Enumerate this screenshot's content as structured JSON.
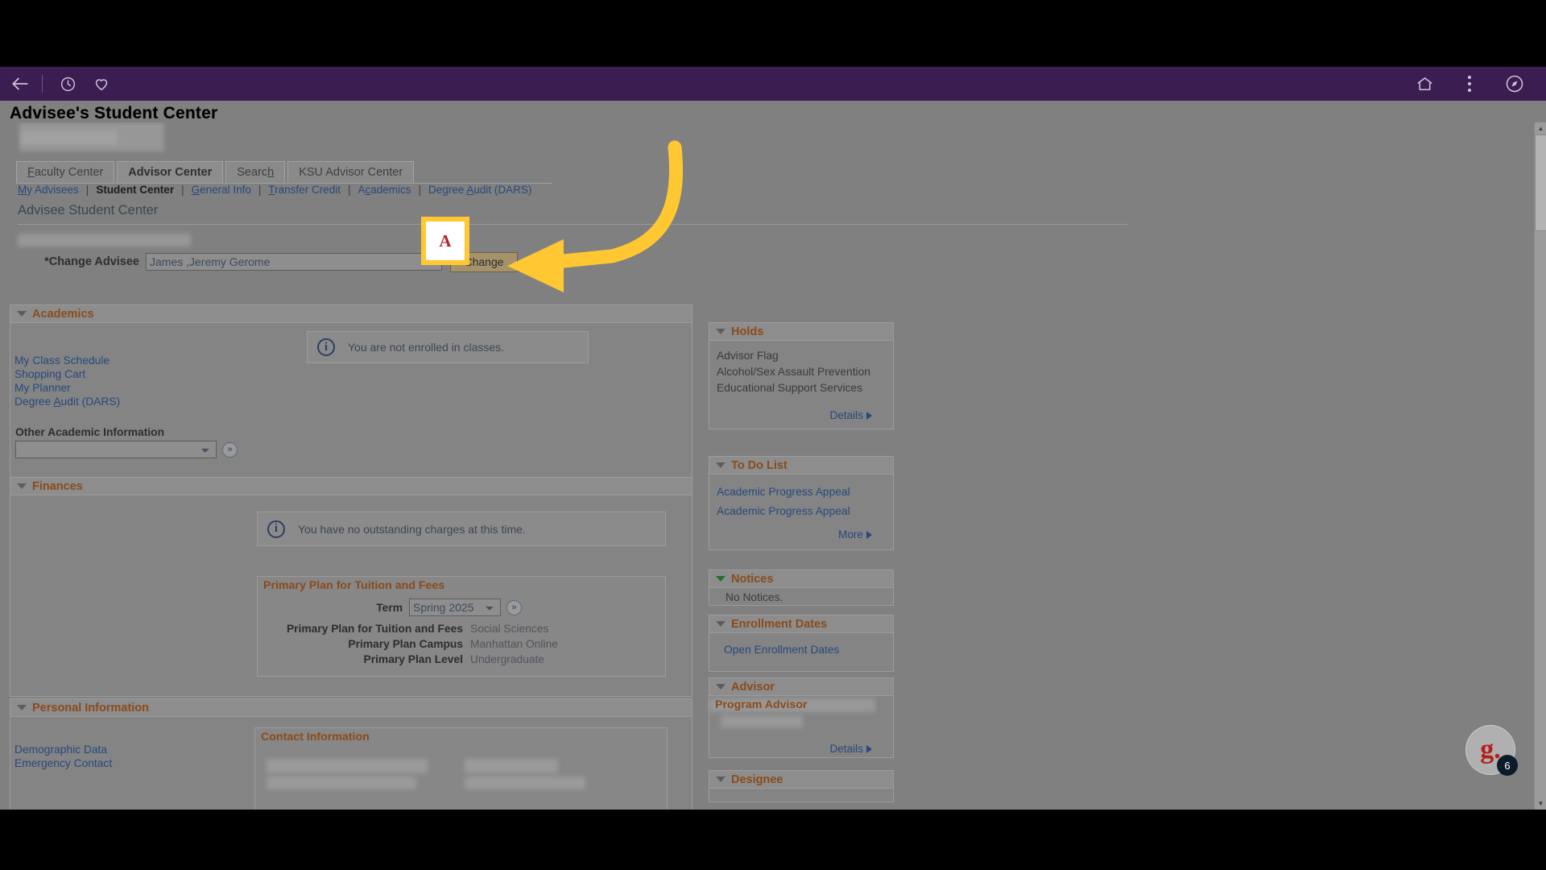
{
  "browser": {
    "icons": [
      "back-arrow-icon",
      "history-clock-icon",
      "favorites-heart-icon",
      "home-icon",
      "overflow-menu-icon",
      "compass-icon"
    ]
  },
  "page": {
    "title": "Advisee's Student Center",
    "section_title": "Advisee Student Center"
  },
  "tabs": [
    {
      "label": "Faculty Center",
      "accesskey": "F",
      "active": false
    },
    {
      "label": "Advisor Center",
      "accesskey": "",
      "active": true
    },
    {
      "label": "Search",
      "accesskey": "h",
      "active": false
    },
    {
      "label": "KSU Advisor Center",
      "accesskey": "",
      "active": false
    }
  ],
  "subnav": [
    {
      "label": "My Advisees",
      "current": false
    },
    {
      "label": "Student Center",
      "current": true
    },
    {
      "label": "General Info",
      "current": false
    },
    {
      "label": "Transfer Credit",
      "current": false
    },
    {
      "label": "Academics",
      "current": false
    },
    {
      "label": "Degree Audit (DARS)",
      "current": false
    }
  ],
  "change_advisee": {
    "label": "*Change Advisee",
    "selected": "James ,Jeremy Gerome",
    "button": "Change"
  },
  "academics": {
    "heading": "Academics",
    "links": [
      "My Class Schedule",
      "Shopping Cart",
      "My Planner",
      "Degree Audit (DARS)"
    ],
    "message": "You are not enrolled in classes.",
    "other_info_label": "Other Academic Information",
    "other_info_value": "",
    "go_label": "≫"
  },
  "finances": {
    "heading": "Finances",
    "message": "You have no outstanding charges at this time.",
    "primary_plan": {
      "heading": "Primary Plan for Tuition and Fees",
      "term_label": "Term",
      "term_value": "Spring 2025",
      "rows": [
        {
          "label": "Primary Plan for Tuition and Fees",
          "value": "Social Sciences"
        },
        {
          "label": "Primary Plan Campus",
          "value": "Manhattan Online"
        },
        {
          "label": "Primary Plan Level",
          "value": "Undergraduate"
        }
      ]
    }
  },
  "personal_information": {
    "heading": "Personal Information",
    "links": [
      "Demographic Data",
      "Emergency Contact"
    ],
    "contact_heading": "Contact Information"
  },
  "rail": {
    "holds": {
      "heading": "Holds",
      "items": [
        "Advisor Flag",
        "Alcohol/Sex Assault Prevention",
        "Educational Support Services"
      ],
      "details": "Details"
    },
    "todo": {
      "heading": "To Do List",
      "items": [
        "Academic Progress Appeal",
        "Academic Progress Appeal"
      ],
      "more": "More"
    },
    "notices": {
      "heading": "Notices",
      "text": "No Notices."
    },
    "enrollment_dates": {
      "heading": "Enrollment Dates",
      "link": "Open Enrollment Dates"
    },
    "advisor": {
      "heading": "Advisor",
      "role": "Program Advisor",
      "details": "Details"
    },
    "designee": {
      "heading": "Designee"
    }
  },
  "annotation": {
    "highlight_glyph": "A",
    "highlight_color": "#ffc832",
    "arrow_color": "#ffc832"
  },
  "fab": {
    "logo": "g.",
    "badge": "6"
  },
  "colors": {
    "chrome_purple": "#3b1d52",
    "page_gray": "#808080",
    "section_heading": "#8a4b1c",
    "link_blue": "#26497d",
    "button_tan": "#a3926a"
  }
}
